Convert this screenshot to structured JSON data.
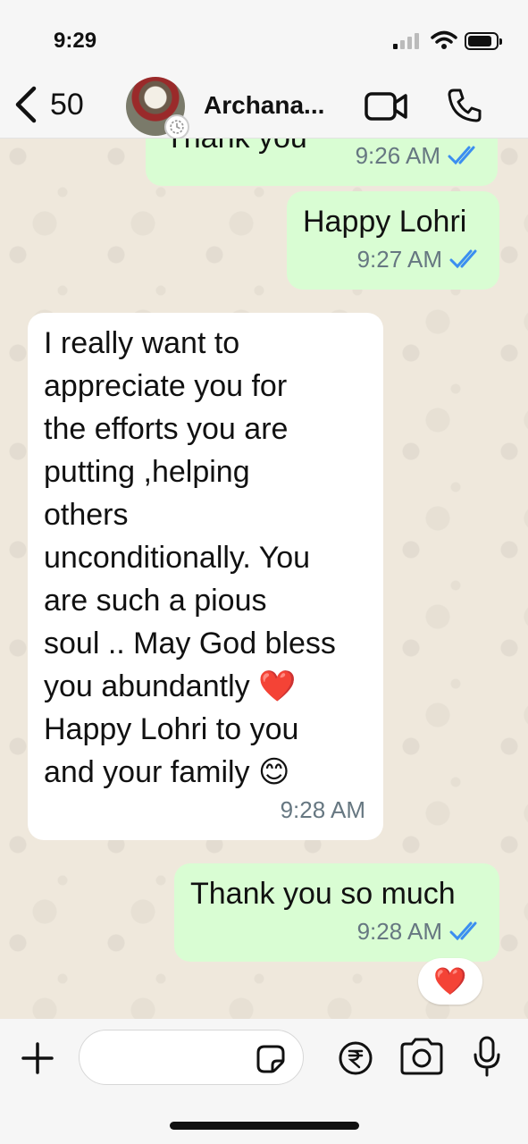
{
  "status_bar": {
    "time": "9:29"
  },
  "header": {
    "back_count": "50",
    "contact_name": "Archana..."
  },
  "messages": [
    {
      "direction": "out",
      "text": "Thank you",
      "time": "9:26 AM"
    },
    {
      "direction": "out",
      "text": "Happy Lohri",
      "time": "9:27 AM"
    },
    {
      "direction": "in",
      "text": "I really want to\nappreciate you for\nthe efforts you are\nputting ,helping\nothers\nunconditionally. You\nare such a pious\nsoul .. May God bless\nyou abundantly ❤️\nHappy Lohri to you\nand your family 😊",
      "time": "9:28 AM"
    },
    {
      "direction": "out",
      "text": "Thank you so much",
      "time": "9:28 AM"
    }
  ],
  "reaction": "❤️",
  "composer": {
    "placeholder": ""
  },
  "icons": [
    "chevron-left-icon",
    "video-call-icon",
    "phone-icon",
    "plus-icon",
    "sticker-icon",
    "rupee-icon",
    "camera-icon",
    "mic-icon",
    "double-check-icon"
  ],
  "colors": {
    "outgoing_bubble": "#d9fdd3",
    "incoming_bubble": "#ffffff",
    "read_ticks": "#3b8ef0",
    "wallpaper": "#efe8dc"
  }
}
